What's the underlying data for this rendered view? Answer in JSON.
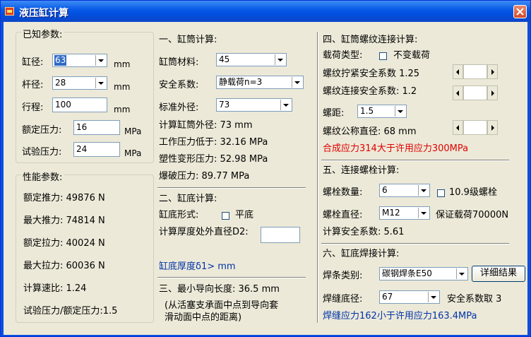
{
  "window": {
    "title": "液压缸计算"
  },
  "known": {
    "group_label": "已知参数:",
    "bore_label": "缸径:",
    "bore_value": "63",
    "bore_unit": "mm",
    "rod_label": "杆径:",
    "rod_value": "28",
    "rod_unit": "mm",
    "stroke_label": "行程:",
    "stroke_value": "100",
    "stroke_unit": "mm",
    "rated_pressure_label": "额定压力:",
    "rated_pressure_value": "16",
    "rated_pressure_unit": "MPa",
    "test_pressure_label": "试验压力:",
    "test_pressure_value": "24",
    "test_pressure_unit": "MPa"
  },
  "performance": {
    "group_label": "性能参数:",
    "rated_thrust": "额定推力: 49876 N",
    "max_thrust": "最大推力: 74814 N",
    "rated_pull": "额定拉力: 40024 N",
    "max_pull": "最大拉力: 60036 N",
    "speed_ratio": "计算速比: 1.24",
    "pressure_ratio": "试验压力/额定压力:1.5"
  },
  "cylinder": {
    "heading": "一、缸筒计算:",
    "material_label": "缸筒材料:",
    "material_value": "45",
    "safety_label": "安全系数:",
    "safety_value": "静载荷n=3",
    "std_od_label": "标准外径:",
    "std_od_value": "73",
    "calc_od": "计算缸筒外径: 73 mm",
    "working_pressure": "工作压力低于: 32.16 MPa",
    "plastic_pressure": "塑性变形压力: 52.98 MPa",
    "burst_pressure": "爆破压力:  89.77 MPa"
  },
  "bottom": {
    "heading": "二、缸底计算:",
    "form_label": "缸底形式:",
    "flat_label": "平底",
    "d2_label": "计算厚度处外直径D2:",
    "d2_value": "",
    "thickness_text": "缸底厚度δ1> mm"
  },
  "guide": {
    "heading": "三、最小导向长度: 36.5 mm",
    "note_line1": "(从活塞支承面中点到导向套",
    "note_line2": "滑动面中点的距离)"
  },
  "thread": {
    "heading": "四、缸筒螺纹连接计算:",
    "load_type_label": "载荷类型:",
    "variable_load_label": "不变载荷",
    "tighten_label": "螺纹拧紧安全系数 1.25",
    "connect_label": "螺纹连接安全系数: 1.2",
    "pitch_label": "螺距:",
    "pitch_value": "1.5",
    "nominal_dia_label": "螺纹公称直径: 68 mm",
    "warning": "合成应力314大于许用应力300MPa"
  },
  "bolt": {
    "heading": "五、连接螺栓计算:",
    "count_label": "螺栓数量:",
    "count_value": "6",
    "grade_label": "10.9级螺栓",
    "dia_label": "螺栓直径:",
    "dia_value": "M12",
    "proof_load": "保证载荷70000N",
    "safety": "计算安全系数: 5.61"
  },
  "weld": {
    "heading": "六、缸底焊接计算:",
    "electrode_label": "焊条类别:",
    "electrode_value": "碳钢焊条E50",
    "detail_button": "详细结果",
    "weld_dia_label": "焊缝底径:",
    "weld_dia_value": "67",
    "safety": "安全系数取 3",
    "stress_text": "焊缝应力162小于许用应力163.4MPa"
  },
  "colors": {
    "info_blue": "#0033aa",
    "warning_red": "#e00000",
    "titlebar": "#0a5ce6"
  }
}
